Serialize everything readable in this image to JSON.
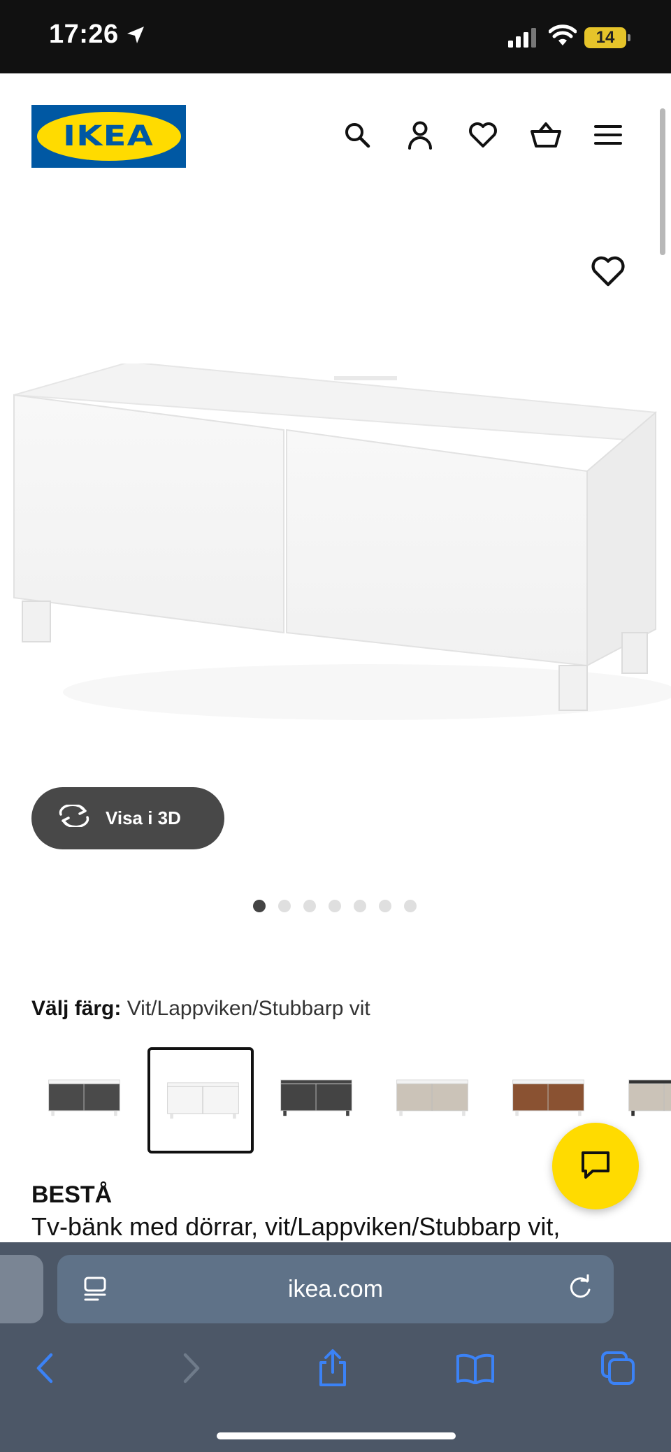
{
  "status_bar": {
    "time": "17:26",
    "battery": "14"
  },
  "header": {
    "logo_text": "IKEA",
    "icons": [
      "search-icon",
      "account-icon",
      "favorites-heart-icon",
      "cart-icon",
      "menu-icon"
    ]
  },
  "gallery": {
    "view_3d_label": "Visa i 3D",
    "image_count": 7,
    "active_image": 1
  },
  "color_selector": {
    "label": "Välj färg:",
    "selected_value": "Vit/Lappviken/Stubbarp vit",
    "swatches": [
      {
        "front": "#4a4a4a",
        "frame": "#f4f4f4",
        "selected": false
      },
      {
        "front": "#f5f5f5",
        "frame": "#f5f5f5",
        "selected": true
      },
      {
        "front": "#444444",
        "frame": "#444444",
        "selected": false
      },
      {
        "front": "#cbc3b8",
        "frame": "#f2f2f2",
        "selected": false
      },
      {
        "front": "#8a5232",
        "frame": "#f2f2f2",
        "selected": false
      },
      {
        "front": "#cbc3b8",
        "frame": "#333333",
        "selected": false
      }
    ]
  },
  "product": {
    "name": "BESTÅ",
    "description": "Tv-bänk med dörrar, vit/Lappviken/Stubbarp vit,"
  },
  "browser": {
    "url": "ikea.com"
  },
  "colors": {
    "ikea_blue": "#0058a3",
    "ikea_yellow": "#ffdb00",
    "safari_link_blue": "#3b82f6"
  }
}
